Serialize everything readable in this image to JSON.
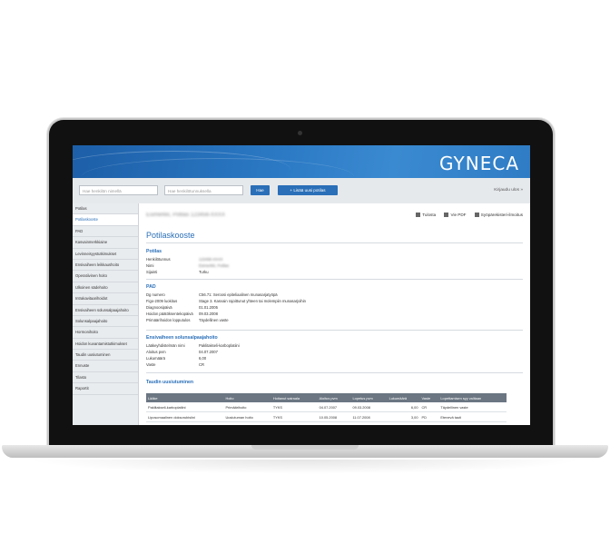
{
  "app": {
    "logo": "GYNECA"
  },
  "search": {
    "name_placeholder": "Hae henkilön nimellä",
    "id_placeholder": "Hae henkilötunnuksella",
    "search_button": "Hae",
    "add_button": "+ Lisää uusi potilas",
    "logout": "Kirjaudu ulos »"
  },
  "sidebar": {
    "items": [
      "Potilas",
      "Potilaskooste",
      "PAD",
      "Kasvainmerkkiaine",
      "Levinneisyystutkimukset",
      "Ensivaiheen leikkaushoito",
      "Operatiivinen hoito",
      "Ulkoinen sädehoito",
      "Intrakavitaarihoidot",
      "Ensivaiheen solunsalpaajahoito",
      "Solunsalpaajahoito",
      "Hormonihoito",
      "Hoidon kuvantamistutkimukset",
      "Taudin uusiutuminen",
      "Ennuste",
      "Tilasto",
      "Raportit"
    ],
    "active_index": 1
  },
  "header": {
    "patient_name": "Esimerkki, Potilas 123456-XXXX",
    "print": "Tulosta",
    "pdf": "Vie PDF",
    "register": "Syöpärekisteri-ilmoitus"
  },
  "content": {
    "title": "Potilaskooste",
    "patient": {
      "heading": "Potilas",
      "rows": [
        {
          "key": "Henkilötunnus",
          "value": "123456-XXXX"
        },
        {
          "key": "Nimi",
          "value": "Esimerkki, Potilas"
        },
        {
          "key": "Sijainti",
          "value": "Turku"
        }
      ]
    },
    "pad": {
      "heading": "PAD",
      "rows": [
        {
          "key": "Dg numero",
          "value": "C56.71: Seroosi epiteliaalinen munasarjatyöpä"
        },
        {
          "key": "Figo-2009 luokitus",
          "value": "Stage 3. Kasvain rajoittunut yhteen tai molempiin munasarjoihin"
        },
        {
          "key": "Diagnoosipäivä",
          "value": "01.01.2005"
        },
        {
          "key": "Hoidon päätöksentekopäivä",
          "value": "09.03.2008"
        },
        {
          "key": "Primäärihoidon lopputulos",
          "value": "Täydellinen vaste"
        }
      ]
    },
    "first_chemo": {
      "heading": "Ensivaiheen solunsalpaajahoito",
      "rows": [
        {
          "key": "Lääkeyhdistelmän nimi",
          "value": "Paklitakseli-karboplatiini"
        },
        {
          "key": "Aloitus pvm",
          "value": "04.07.2007"
        },
        {
          "key": "Lukumäärä",
          "value": "6,00"
        },
        {
          "key": "Vaste",
          "value": "CR"
        }
      ]
    },
    "recurrence": {
      "heading": "Taudin uusiutuminen",
      "columns": [
        "Lääke",
        "Hoito",
        "Hoitanut sairaala",
        "Aloitus pvm",
        "Lopetus pvm",
        "Lukumäärä",
        "Vaste",
        "Lopettamisen syy valitaan"
      ],
      "rows": [
        [
          "Paklitakseli-karboplatiini",
          "Primäärihoito",
          "TYKS",
          "04.07.2007",
          "09.03.2008",
          "6,00",
          "CR",
          "Täydellinen vaste"
        ],
        [
          "Liposomaalinen doksorubisiini",
          "Uusiutuman hoito",
          "TYKS",
          "10.05.2008",
          "11.07.2008",
          "3,00",
          "PD",
          "Etenevä tauti"
        ]
      ]
    }
  }
}
